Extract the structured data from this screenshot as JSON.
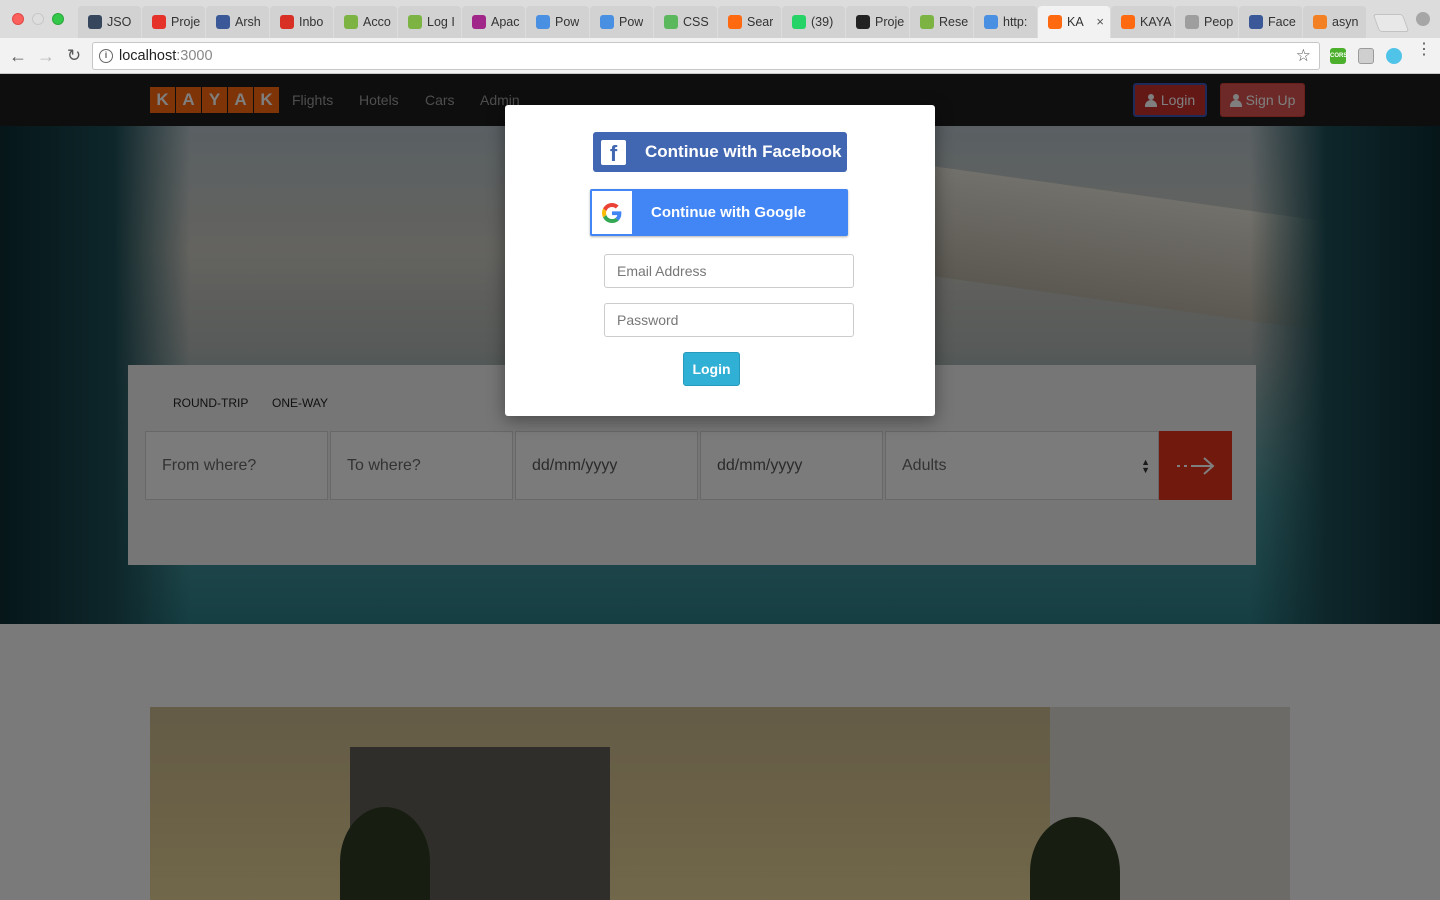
{
  "browser": {
    "tabs": [
      {
        "title": "JSO",
        "icon": "json-icon",
        "color": "#36465d",
        "active": false
      },
      {
        "title": "Proje",
        "icon": "lifebuoy-icon",
        "color": "#e5332a",
        "active": false
      },
      {
        "title": "Arsh",
        "icon": "facebook-icon",
        "color": "#3b5998",
        "active": false
      },
      {
        "title": "Inbo",
        "icon": "gmail-icon",
        "color": "#d93025",
        "active": false
      },
      {
        "title": "Acco",
        "icon": "recycle-icon",
        "color": "#7cb342",
        "active": false
      },
      {
        "title": "Log I",
        "icon": "recycle-icon",
        "color": "#7cb342",
        "active": false
      },
      {
        "title": "Apac",
        "icon": "feather-icon",
        "color": "#a1268a",
        "active": false
      },
      {
        "title": "Pow",
        "icon": "p-icon",
        "color": "#4a90e2",
        "active": false
      },
      {
        "title": "Pow",
        "icon": "p-icon",
        "color": "#4a90e2",
        "active": false
      },
      {
        "title": "CSS",
        "icon": "css-icon",
        "color": "#5cb85c",
        "active": false
      },
      {
        "title": "Sear",
        "icon": "kayak-icon",
        "color": "#ff690f",
        "active": false
      },
      {
        "title": "(39)",
        "icon": "badge-icon",
        "color": "#25d366",
        "active": false
      },
      {
        "title": "Proje",
        "icon": "github-icon",
        "color": "#222222",
        "active": false
      },
      {
        "title": "Rese",
        "icon": "recycle-icon",
        "color": "#7cb342",
        "active": false
      },
      {
        "title": "http:",
        "icon": "p-icon",
        "color": "#4a90e2",
        "active": false
      },
      {
        "title": "KA",
        "icon": "kayak-icon",
        "color": "#ff690f",
        "active": true
      },
      {
        "title": "KAYA",
        "icon": "kayak-icon",
        "color": "#ff690f",
        "active": false
      },
      {
        "title": "Peop",
        "icon": "document-icon",
        "color": "#9e9e9e",
        "active": false
      },
      {
        "title": "Face",
        "icon": "facebook-icon",
        "color": "#3b5998",
        "active": false
      },
      {
        "title": "asyn",
        "icon": "stackoverflow-icon",
        "color": "#f48024",
        "active": false
      }
    ],
    "url_host": "localhost",
    "url_port": ":3000",
    "extension_label": "CORS"
  },
  "navbar": {
    "logo_letters": [
      "K",
      "A",
      "Y",
      "A",
      "K"
    ],
    "links": [
      "Flights",
      "Hotels",
      "Cars",
      "Admin"
    ],
    "login_label": "Login",
    "signup_label": "Sign Up"
  },
  "search": {
    "trip_types": [
      "ROUND-TRIP",
      "ONE-WAY"
    ],
    "from_placeholder": "From where?",
    "to_placeholder": "To where?",
    "depart_placeholder": "dd/mm/yyyy",
    "return_placeholder": "dd/mm/yyyy",
    "travelers_value": "Adults"
  },
  "modal": {
    "facebook_label": "Continue with Facebook",
    "google_label": "Continue with Google",
    "email_placeholder": "Email Address",
    "password_placeholder": "Password",
    "login_label": "Login"
  },
  "colors": {
    "brand_orange": "#ff690f",
    "facebook_blue": "#4267b2",
    "google_blue": "#4285f4",
    "login_cyan": "#31b0d5",
    "danger_red": "#d9534f"
  }
}
